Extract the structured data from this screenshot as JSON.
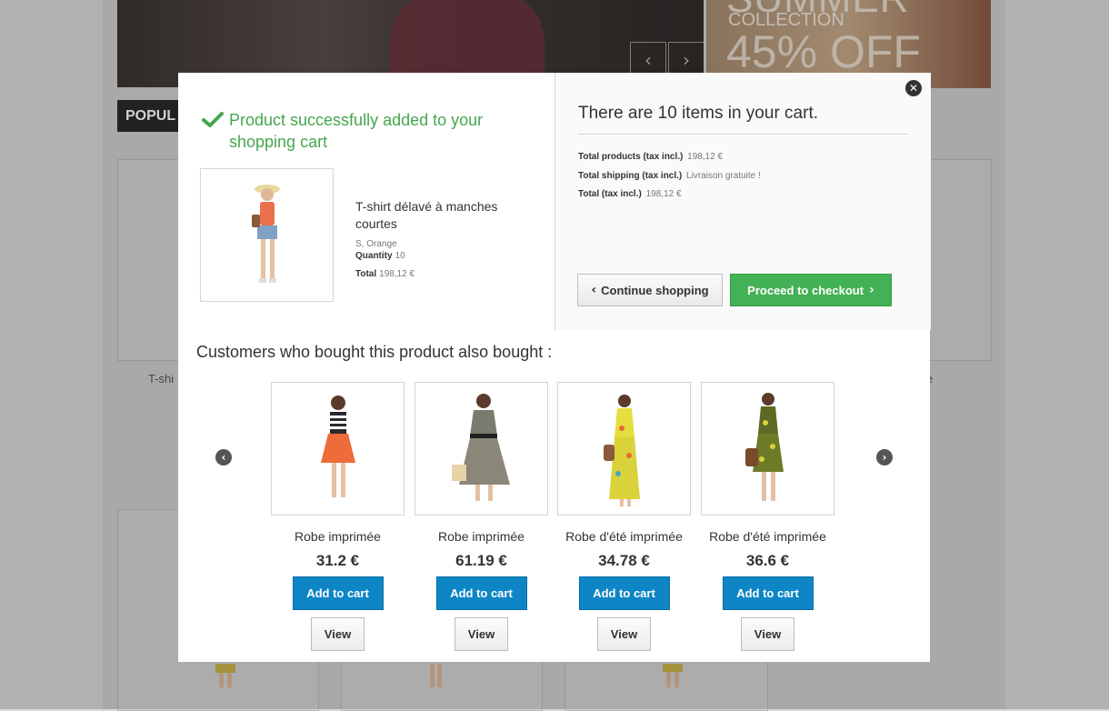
{
  "background": {
    "banner_text_1": "SUMMER",
    "banner_text_2": "COLLECTION",
    "banner_text_3": "45% OFF",
    "section_tab": "POPUL",
    "card_text_left": "T-shi",
    "card_text_right": "e",
    "slider_prev_icon": "chevron-left-icon",
    "slider_next_icon": "chevron-right-icon"
  },
  "modal": {
    "close_icon": "close-icon",
    "success_message": "Product successfully added to your shopping cart",
    "product": {
      "name": "T-shirt délavé à manches courtes",
      "attributes": "S, Orange",
      "quantity_label": "Quantity",
      "quantity_value": "10",
      "total_label": "Total",
      "total_value": "198,12 €"
    },
    "cart": {
      "title": "There are 10 items in your cart.",
      "total_products_label": "Total products (tax incl.)",
      "total_products_value": "198,12 €",
      "total_shipping_label": "Total shipping (tax incl.)",
      "total_shipping_value": "Livraison gratuite !",
      "total_label": "Total (tax incl.)",
      "total_value": "198,12 €",
      "continue_label": "Continue shopping",
      "checkout_label": "Proceed to checkout"
    },
    "also_bought": {
      "title": "Customers who bought this product also bought :",
      "items": [
        {
          "name": "Robe imprimée",
          "price": "31.2 €",
          "add_label": "Add to cart",
          "view_label": "View"
        },
        {
          "name": "Robe imprimée",
          "price": "61.19 €",
          "add_label": "Add to cart",
          "view_label": "View"
        },
        {
          "name": "Robe d'été imprimée",
          "price": "34.78 €",
          "add_label": "Add to cart",
          "view_label": "View"
        },
        {
          "name": "Robe d'été imprimée",
          "price": "36.6 €",
          "add_label": "Add to cart",
          "view_label": "View"
        }
      ]
    }
  },
  "colors": {
    "success_green": "#46a74e",
    "checkout_green": "#43b155",
    "add_to_cart_blue": "#0e86c5"
  }
}
